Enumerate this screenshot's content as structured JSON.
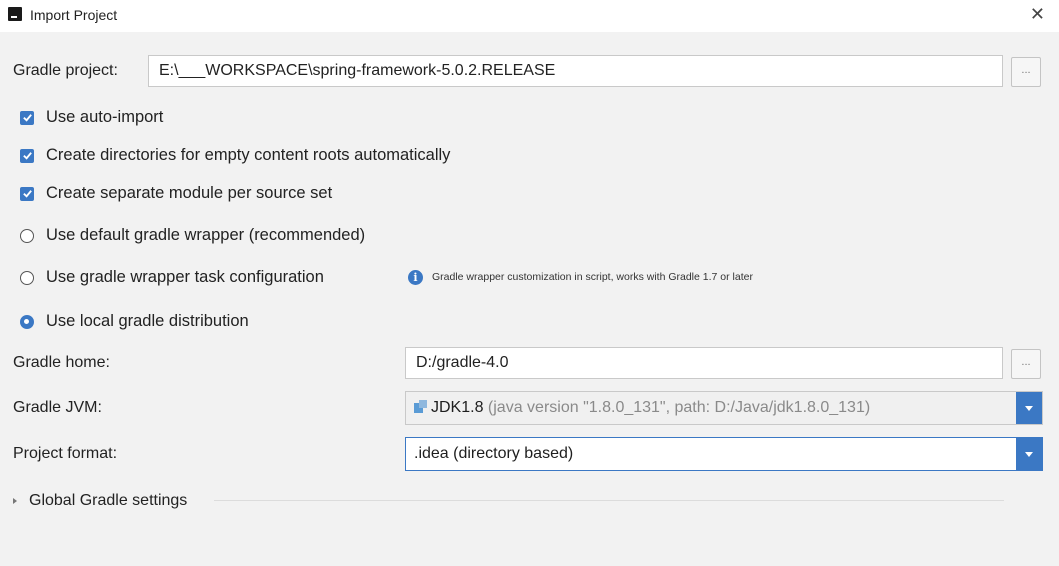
{
  "window": {
    "title": "Import Project",
    "close_glyph": "✕"
  },
  "gradle_project": {
    "label": "Gradle project:",
    "value": "E:\\___WORKSPACE\\spring-framework-5.0.2.RELEASE",
    "browse_label": "..."
  },
  "options": {
    "auto_import": {
      "label": "Use auto-import",
      "checked": true
    },
    "create_dirs": {
      "label": "Create directories for empty content roots automatically",
      "checked": true
    },
    "separate_module": {
      "label": "Create separate module per source set",
      "checked": true
    }
  },
  "gradle_source": {
    "default_wrapper": {
      "label": "Use default gradle wrapper (recommended)",
      "selected": false
    },
    "wrapper_task": {
      "label": "Use gradle wrapper task configuration",
      "selected": false
    },
    "wrapper_task_info": "Gradle wrapper customization in script, works with Gradle 1.7 or later",
    "local_distribution": {
      "label": "Use local gradle distribution",
      "selected": true
    }
  },
  "gradle_home": {
    "label": "Gradle home:",
    "value": "D:/gradle-4.0",
    "browse_label": "..."
  },
  "gradle_jvm": {
    "label": "Gradle JVM:",
    "value_name": "JDK1.8",
    "value_detail": "(java version \"1.8.0_131\", path: D:/Java/jdk1.8.0_131)"
  },
  "project_format": {
    "label": "Project format:",
    "value": ".idea (directory based)"
  },
  "global_settings": {
    "label": "Global Gradle settings"
  },
  "colors": {
    "accent": "#3b78c4",
    "dialog_bg": "#f2f2f2"
  }
}
